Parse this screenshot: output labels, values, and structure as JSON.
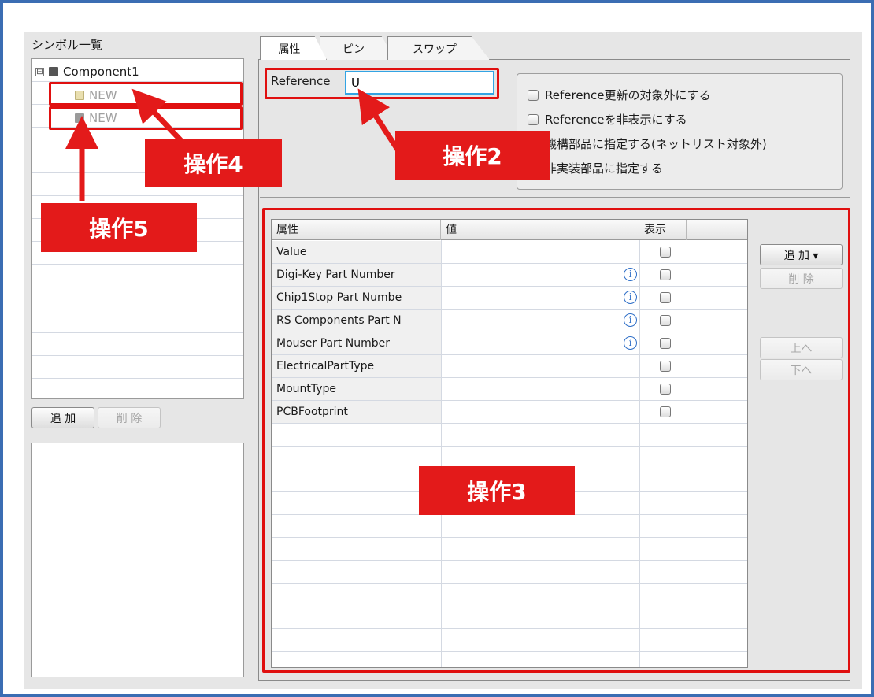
{
  "left_panel": {
    "title": "シンボル一覧",
    "tree": {
      "root_label": "Component1",
      "expander": "⊟",
      "children": [
        {
          "label": "NEW",
          "icon": "component-icon"
        },
        {
          "label": "NEW",
          "icon": "component-icon"
        }
      ]
    },
    "add_button": "追 加",
    "delete_button": "削 除"
  },
  "tabs": [
    {
      "label": "属性",
      "active": true
    },
    {
      "label": "ピン",
      "active": false
    },
    {
      "label": "スワップ",
      "active": false
    }
  ],
  "reference": {
    "label": "Reference",
    "value": "U"
  },
  "options": [
    {
      "label": "Reference更新の対象外にする",
      "checked": false
    },
    {
      "label": "Referenceを非表示にする",
      "checked": false
    },
    {
      "label": "機構部品に指定する(ネットリスト対象外)",
      "checked": false
    },
    {
      "label": "非実装部品に指定する",
      "checked": false
    }
  ],
  "attribute_grid": {
    "columns": [
      "属性",
      "値",
      "表示"
    ],
    "rows": [
      {
        "name": "Value",
        "value": "",
        "info": false,
        "shown": false
      },
      {
        "name": "Digi-Key Part Number",
        "value": "",
        "info": true,
        "shown": false
      },
      {
        "name": "Chip1Stop Part Numbe",
        "value": "",
        "info": true,
        "shown": false
      },
      {
        "name": "RS Components Part N",
        "value": "",
        "info": true,
        "shown": false
      },
      {
        "name": "Mouser Part Number",
        "value": "",
        "info": true,
        "shown": false
      },
      {
        "name": "ElectricalPartType",
        "value": "",
        "info": false,
        "shown": false
      },
      {
        "name": "MountType",
        "value": "",
        "info": false,
        "shown": false
      },
      {
        "name": "PCBFootprint",
        "value": "",
        "info": false,
        "shown": false
      }
    ],
    "info_glyph": "i"
  },
  "side_buttons": {
    "add": "追 加 ▾",
    "delete": "削 除",
    "up": "上へ",
    "down": "下へ"
  },
  "annotations": {
    "op2": "操作2",
    "op3": "操作3",
    "op4": "操作4",
    "op5": "操作5"
  },
  "colors": {
    "annotation_red": "#e31a1a",
    "input_focus": "#33a4e4",
    "frame_blue": "#3b6db3"
  }
}
